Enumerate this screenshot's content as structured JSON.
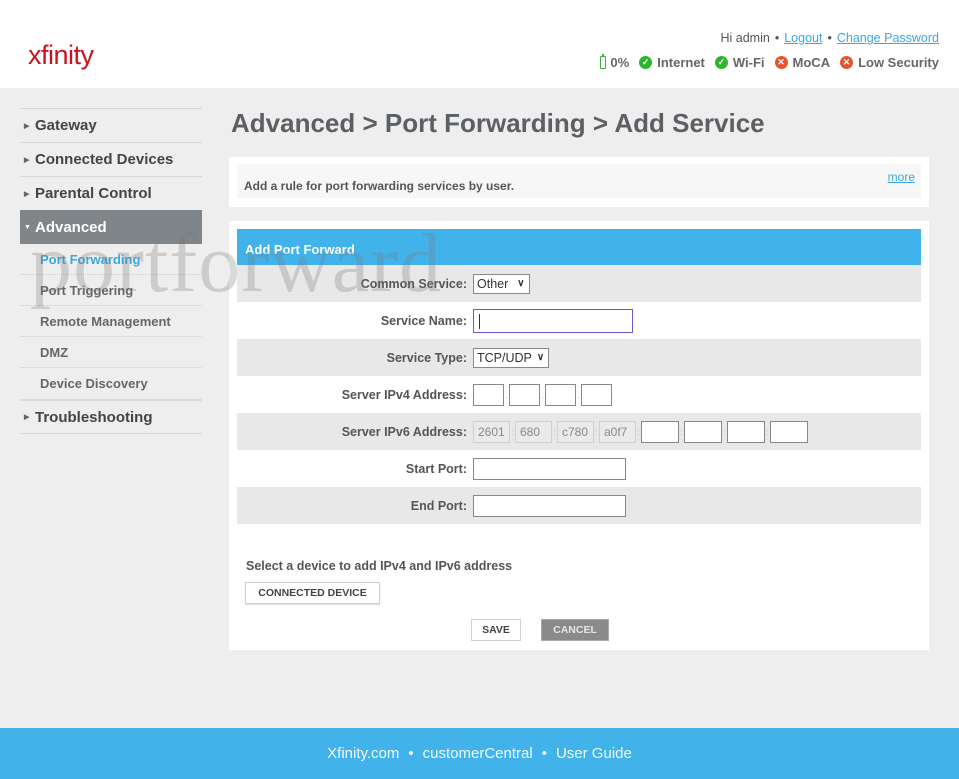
{
  "header": {
    "logo": "xfinity",
    "greeting": "Hi admin",
    "logout_label": "Logout",
    "change_password_label": "Change Password",
    "status": [
      {
        "icon": "battery-icon",
        "label": "0%",
        "state": "neutral"
      },
      {
        "icon": "check-circle-icon",
        "label": "Internet",
        "state": "ok"
      },
      {
        "icon": "check-circle-icon",
        "label": "Wi-Fi",
        "state": "ok"
      },
      {
        "icon": "x-circle-icon",
        "label": "MoCA",
        "state": "error"
      },
      {
        "icon": "x-circle-icon",
        "label": "Low Security",
        "state": "error"
      }
    ],
    "colors": {
      "ok": "#2db52d",
      "error": "#e2552d",
      "brand": "#c8141e"
    }
  },
  "sidebar": {
    "items": [
      {
        "label": "Gateway"
      },
      {
        "label": "Connected Devices"
      },
      {
        "label": "Parental Control"
      },
      {
        "label": "Advanced",
        "expanded": true,
        "children": [
          {
            "label": "Port Forwarding",
            "current": true
          },
          {
            "label": "Port Triggering"
          },
          {
            "label": "Remote Management"
          },
          {
            "label": "DMZ"
          },
          {
            "label": "Device Discovery"
          }
        ]
      },
      {
        "label": "Troubleshooting"
      }
    ]
  },
  "main": {
    "title": "Advanced > Port Forwarding > Add Service",
    "info_text": "Add a rule for port forwarding services by user.",
    "more_label": "more",
    "form": {
      "header": "Add Port Forward",
      "common_service_label": "Common Service:",
      "common_service_value": "Other",
      "service_name_label": "Service Name:",
      "service_name_value": "",
      "service_type_label": "Service Type:",
      "service_type_value": "TCP/UDP",
      "ipv4_label": "Server IPv4 Address:",
      "ipv4_octets": [
        "",
        "",
        "",
        ""
      ],
      "ipv4_sep": ".",
      "ipv6_label": "Server IPv6 Address:",
      "ipv6_prefix": [
        "2601",
        "680",
        "c780",
        "a0f7"
      ],
      "ipv6_suffix": [
        "",
        "",
        "",
        ""
      ],
      "ipv6_sep": ":",
      "start_port_label": "Start Port:",
      "start_port_value": "",
      "end_port_label": "End Port:",
      "end_port_value": "",
      "select_device_note": "Select a device to add IPv4 and IPv6 address",
      "connected_device_label": "CONNECTED DEVICE",
      "save_label": "SAVE",
      "cancel_label": "CANCEL"
    }
  },
  "watermark": "portforward",
  "footer": {
    "links": [
      "Xfinity.com",
      "customerCentral",
      "User Guide"
    ],
    "separator": "•"
  }
}
